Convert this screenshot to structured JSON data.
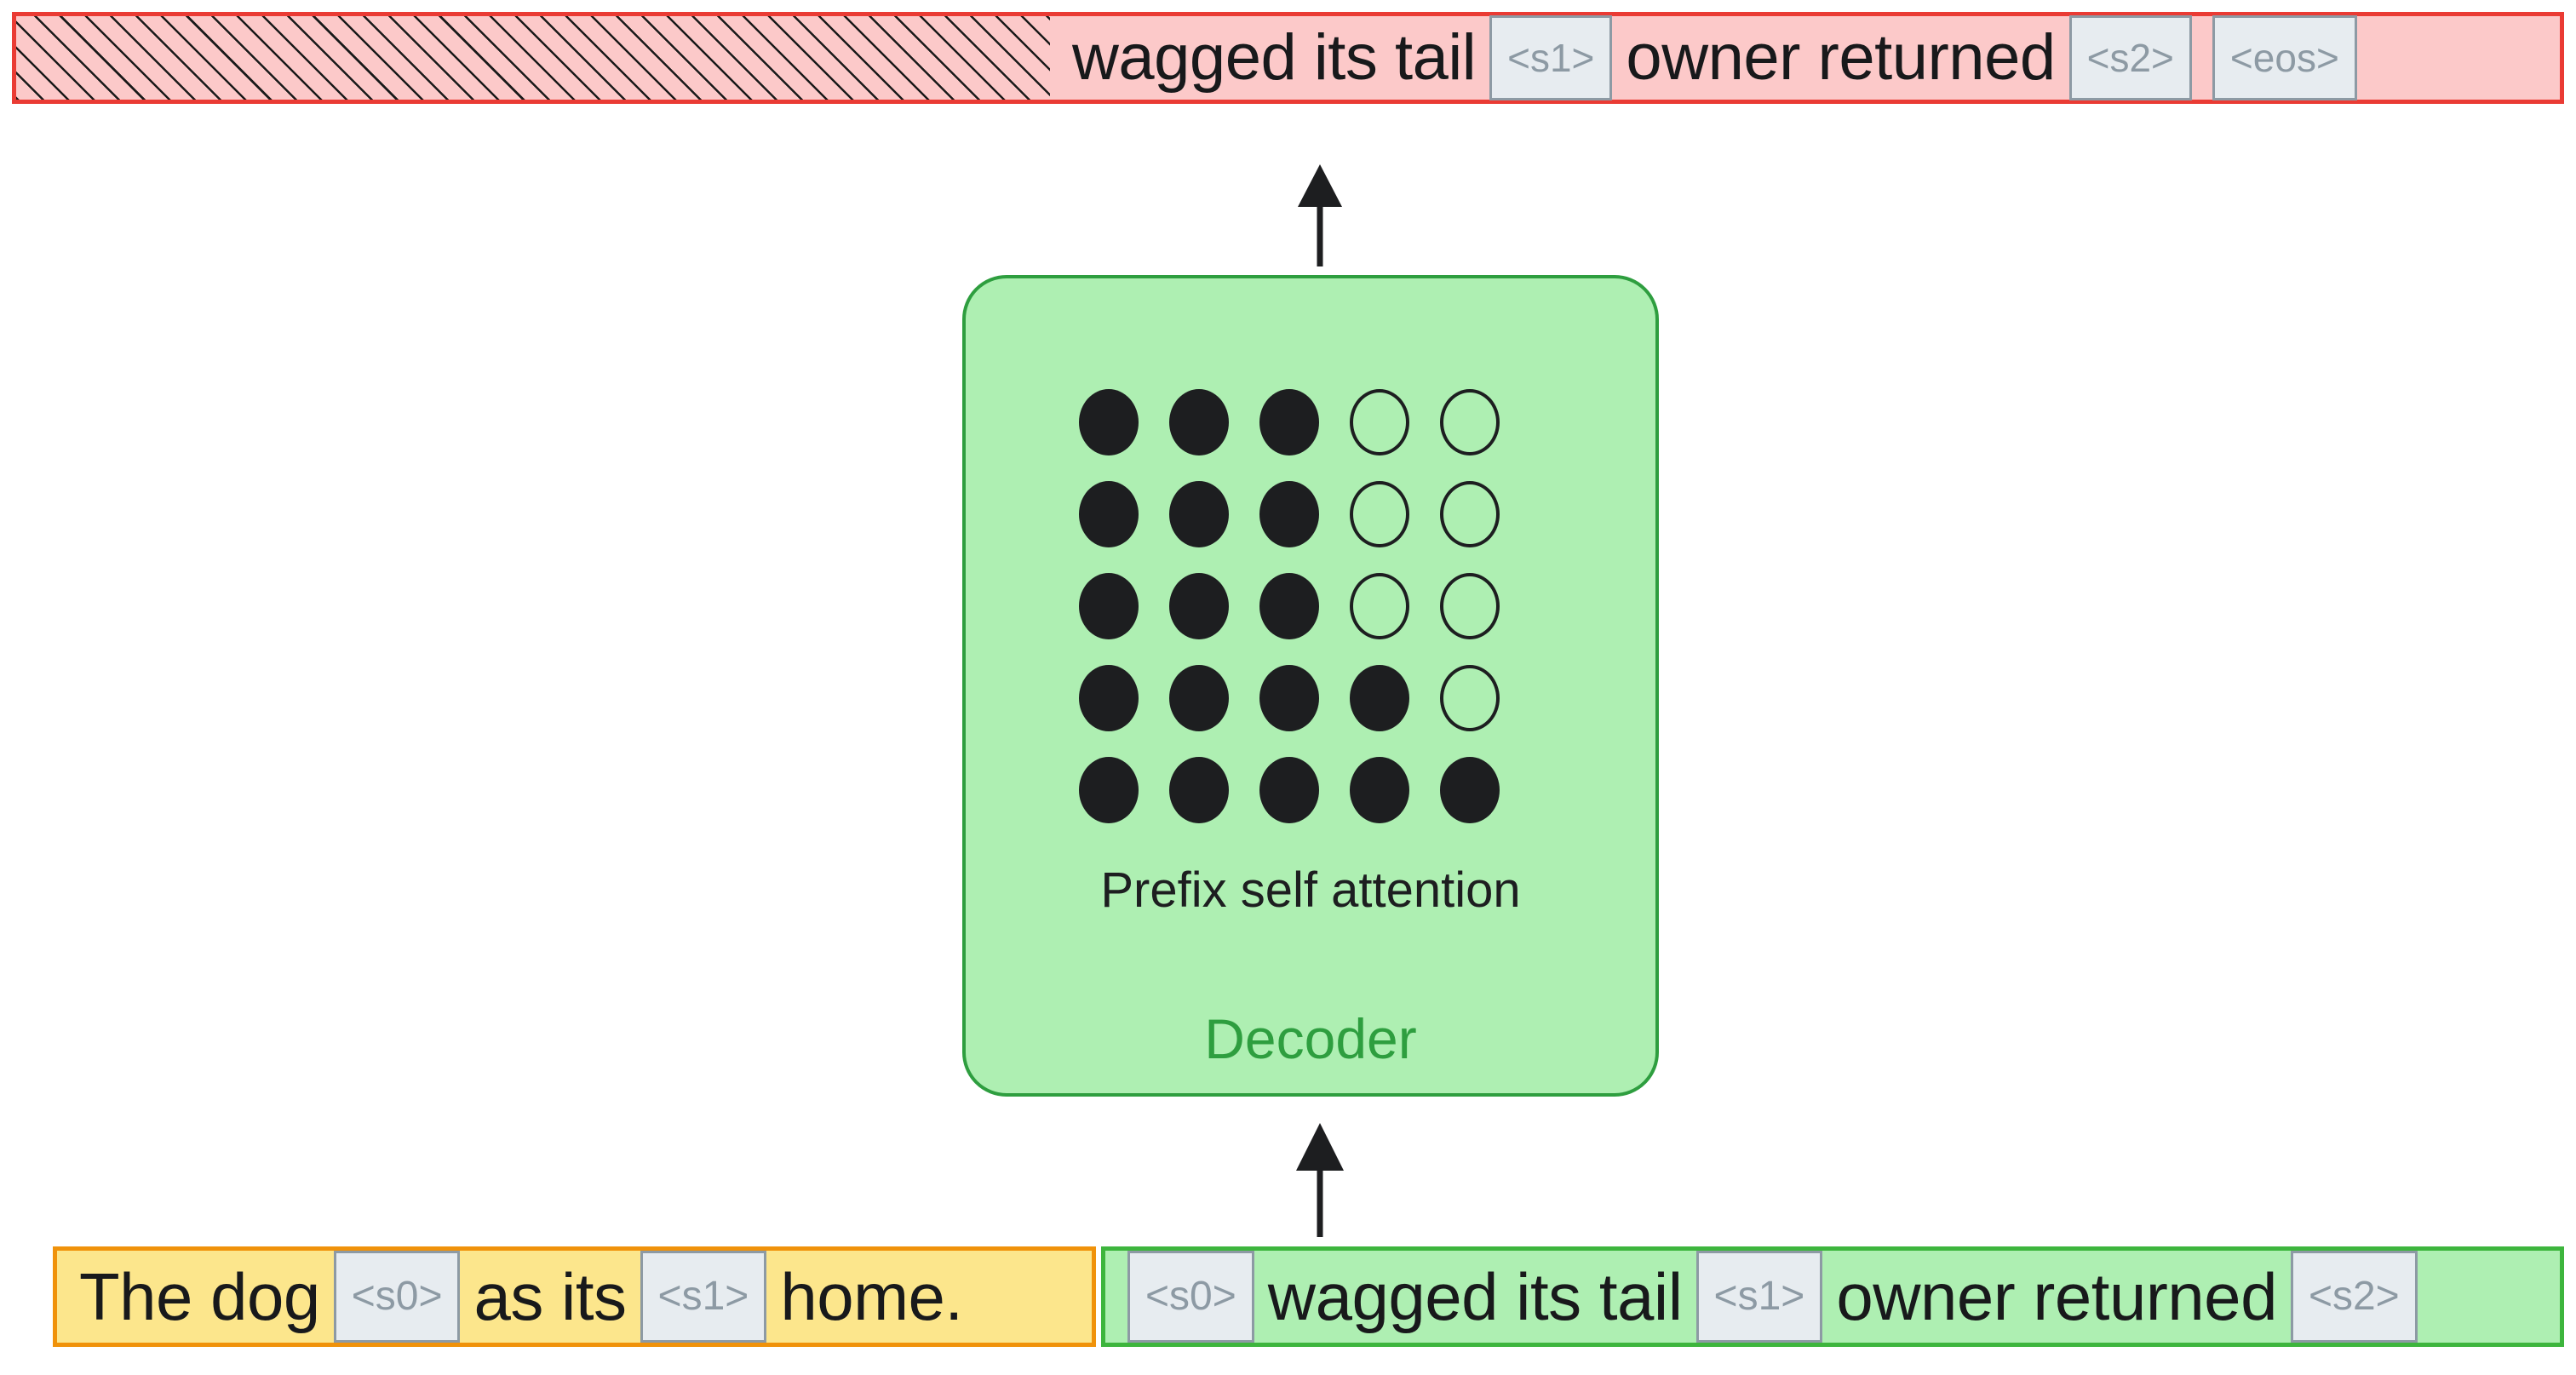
{
  "diagram": {
    "title": "Prefix LM decoder with sentinel tokens",
    "colors": {
      "output_fill": "#fcc9c9",
      "output_border": "#ea3b34",
      "decoder_fill": "#aeefb2",
      "decoder_border": "#2e9e3f",
      "decoder_label_color": "#2e9e3f",
      "source_fill": "#fce68c",
      "source_border": "#f0920a",
      "target_fill": "#aeefb2",
      "target_border": "#3db53d",
      "sentinel_fill": "#e7ecf0",
      "sentinel_border": "#8d9aa4",
      "sentinel_text": "#8d9aa4",
      "dot_color": "#1d1e20"
    }
  },
  "output_bar": {
    "masked_region_label": "",
    "tokens": [
      {
        "type": "word",
        "text": "wagged its tail"
      },
      {
        "type": "sentinel",
        "text": "<s1>"
      },
      {
        "type": "word",
        "text": "owner returned"
      },
      {
        "type": "sentinel",
        "text": "<s2>"
      },
      {
        "type": "sentinel",
        "text": "<eos>"
      }
    ]
  },
  "decoder": {
    "label": "Decoder",
    "attention_caption": "Prefix self attention",
    "attention_matrix": {
      "rows": 5,
      "cols": 5,
      "cells": [
        [
          1,
          1,
          1,
          0,
          0
        ],
        [
          1,
          1,
          1,
          0,
          0
        ],
        [
          1,
          1,
          1,
          0,
          0
        ],
        [
          1,
          1,
          1,
          1,
          0
        ],
        [
          1,
          1,
          1,
          1,
          1
        ]
      ]
    }
  },
  "source_bar": {
    "tokens": [
      {
        "type": "word",
        "text": "The dog"
      },
      {
        "type": "sentinel",
        "text": "<s0>"
      },
      {
        "type": "word",
        "text": "as its"
      },
      {
        "type": "sentinel",
        "text": "<s1>"
      },
      {
        "type": "word",
        "text": "home."
      }
    ]
  },
  "target_bar": {
    "tokens": [
      {
        "type": "sentinel",
        "text": "<s0>"
      },
      {
        "type": "word",
        "text": "wagged its tail"
      },
      {
        "type": "sentinel",
        "text": "<s1>"
      },
      {
        "type": "word",
        "text": "owner returned"
      },
      {
        "type": "sentinel",
        "text": "<s2>"
      }
    ]
  },
  "arrows": [
    {
      "name": "decoder-to-output-arrow",
      "direction": "up"
    },
    {
      "name": "input-to-decoder-arrow",
      "direction": "up"
    }
  ]
}
